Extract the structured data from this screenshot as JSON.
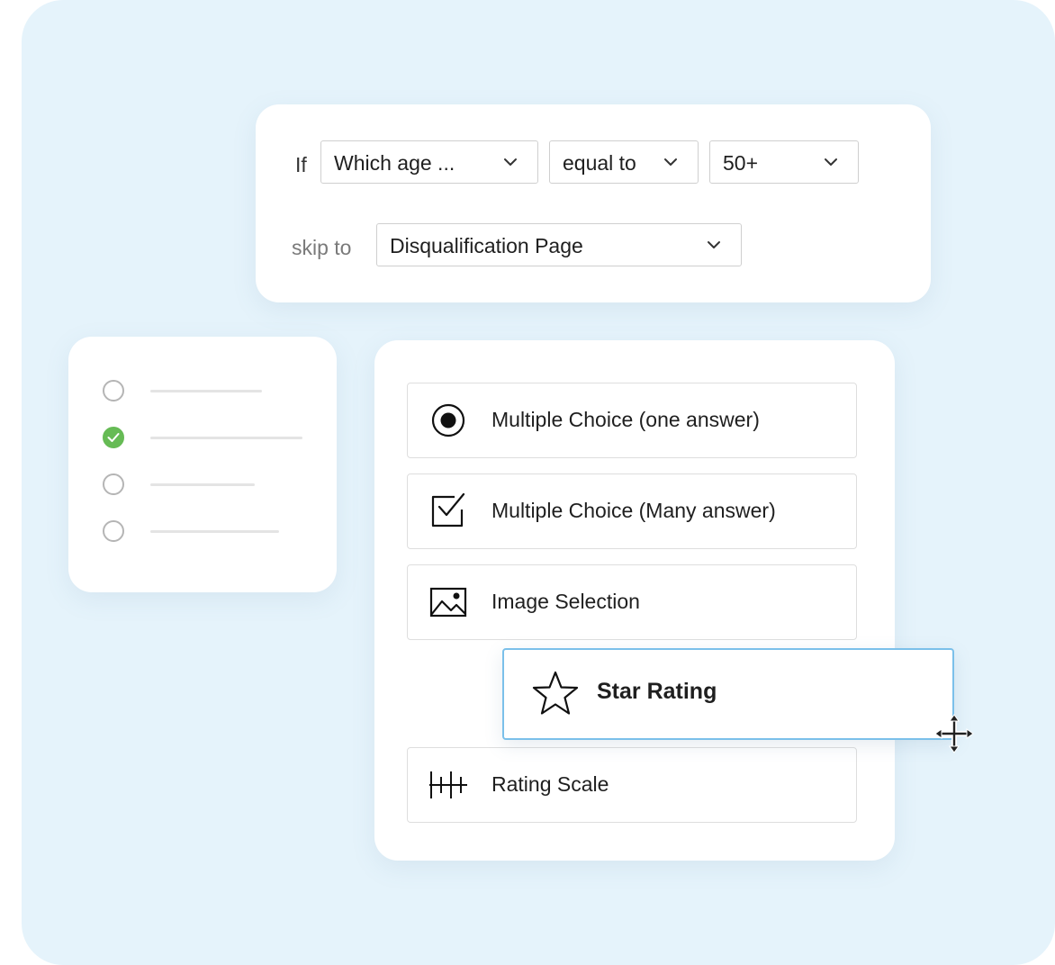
{
  "logic": {
    "if_label": "If",
    "question_value": "Which age ...",
    "operator_value": "equal to",
    "answer_value": "50+",
    "skip_label": "skip to",
    "target_value": "Disqualification Page"
  },
  "checklist": {
    "items": [
      {
        "checked": false
      },
      {
        "checked": true
      },
      {
        "checked": false
      },
      {
        "checked": false
      }
    ],
    "check_color": "#66bb55"
  },
  "question_types": {
    "items": [
      {
        "label": "Multiple Choice (one answer)",
        "icon": "radio-button-icon"
      },
      {
        "label": "Multiple Choice (Many answer)",
        "icon": "checkbox-icon"
      },
      {
        "label": "Image Selection",
        "icon": "image-icon"
      },
      {
        "label": "Rating Scale",
        "icon": "rating-scale-icon"
      }
    ],
    "dragged_item": {
      "label": "Star Rating",
      "icon": "star-icon"
    }
  },
  "colors": {
    "background": "#e5f3fb",
    "drag_border": "#7bc0ea"
  }
}
